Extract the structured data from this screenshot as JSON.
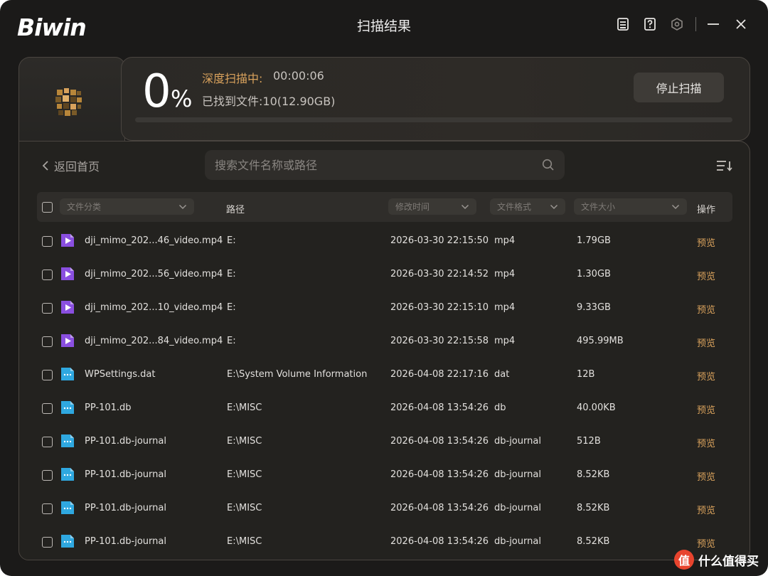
{
  "app": {
    "logo": "Biwin",
    "title": "扫描结果"
  },
  "scan": {
    "percent": "0",
    "percent_sign": "%",
    "progress_fraction": 0.0,
    "status": "深度扫描中:",
    "elapsed": "00:00:06",
    "found": "已找到文件:10(12.90GB)",
    "stop_label": "停止扫描"
  },
  "nav": {
    "back_label": "返回首页"
  },
  "search": {
    "placeholder": "搜索文件名称或路径"
  },
  "table": {
    "headers": {
      "category": "文件分类",
      "path": "路径",
      "modified": "修改时间",
      "format": "文件格式",
      "size": "文件大小",
      "action": "操作"
    },
    "rows": [
      {
        "name": "dji_mimo_202...46_video.mp4",
        "path": "E:",
        "modified": "2026-03-30 22:15:50",
        "format": "mp4",
        "size": "1.79GB",
        "action": "预览",
        "icon": "video"
      },
      {
        "name": "dji_mimo_202...56_video.mp4",
        "path": "E:",
        "modified": "2026-03-30 22:14:52",
        "format": "mp4",
        "size": "1.30GB",
        "action": "预览",
        "icon": "video"
      },
      {
        "name": "dji_mimo_202...10_video.mp4",
        "path": "E:",
        "modified": "2026-03-30 22:15:10",
        "format": "mp4",
        "size": "9.33GB",
        "action": "预览",
        "icon": "video"
      },
      {
        "name": "dji_mimo_202...84_video.mp4",
        "path": "E:",
        "modified": "2026-03-30 22:15:58",
        "format": "mp4",
        "size": "495.99MB",
        "action": "预览",
        "icon": "video"
      },
      {
        "name": "WPSettings.dat",
        "path": "E:\\System Volume Information",
        "modified": "2026-04-08 22:17:16",
        "format": "dat",
        "size": "12B",
        "action": "预览",
        "icon": "file"
      },
      {
        "name": "PP-101.db",
        "path": "E:\\MISC",
        "modified": "2026-04-08 13:54:26",
        "format": "db",
        "size": "40.00KB",
        "action": "预览",
        "icon": "file"
      },
      {
        "name": "PP-101.db-journal",
        "path": "E:\\MISC",
        "modified": "2026-04-08 13:54:26",
        "format": "db-journal",
        "size": "512B",
        "action": "预览",
        "icon": "file"
      },
      {
        "name": "PP-101.db-journal",
        "path": "E:\\MISC",
        "modified": "2026-04-08 13:54:26",
        "format": "db-journal",
        "size": "8.52KB",
        "action": "预览",
        "icon": "file"
      },
      {
        "name": "PP-101.db-journal",
        "path": "E:\\MISC",
        "modified": "2026-04-08 13:54:26",
        "format": "db-journal",
        "size": "8.52KB",
        "action": "预览",
        "icon": "file"
      },
      {
        "name": "PP-101.db-journal",
        "path": "E:\\MISC",
        "modified": "2026-04-08 13:54:26",
        "format": "db-journal",
        "size": "8.52KB",
        "action": "预览",
        "icon": "file"
      }
    ]
  },
  "watermark": {
    "badge": "值",
    "text": "什么值得买"
  },
  "colors": {
    "accent": "#d9a25c",
    "video_icon": "#8a4fe0",
    "file_icon": "#2fa8e0",
    "background": "#1b1a19"
  }
}
